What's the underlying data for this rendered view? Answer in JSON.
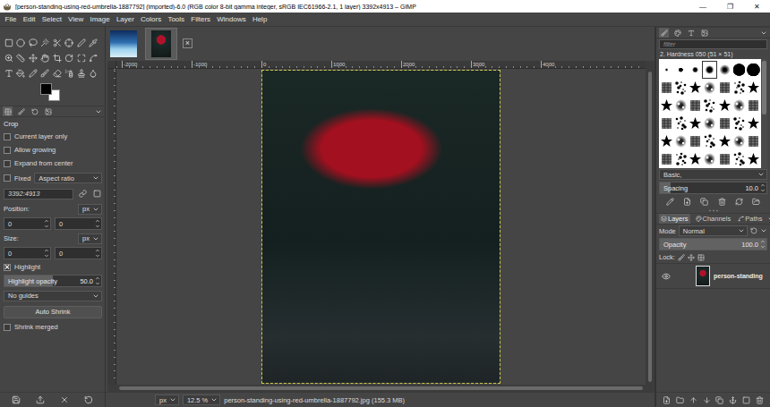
{
  "window": {
    "title": "[person-standing-using-red-umbrella-1887792] (imported)-6.0 (RGB color 8-bit gamma integer, sRGB IEC61966-2.1, 1 layer) 3392x4913 – GIMP",
    "controls": [
      "—",
      "❐",
      "✕"
    ]
  },
  "menu": [
    "File",
    "Edit",
    "Select",
    "View",
    "Image",
    "Layer",
    "Colors",
    "Tools",
    "Filters",
    "Windows",
    "Help"
  ],
  "image_tabs": {
    "items": [
      {
        "selected": false
      },
      {
        "selected": true
      }
    ],
    "close": "×"
  },
  "tool_options": {
    "tool": "Crop",
    "rows": [
      {
        "kind": "checkbox",
        "label": "Current layer only",
        "checked": false
      },
      {
        "kind": "checkbox",
        "label": "Allow growing",
        "checked": false
      },
      {
        "kind": "checkbox",
        "label": "Expand from center",
        "checked": false
      },
      {
        "kind": "fixed",
        "label": "Fixed",
        "checked": false,
        "value": "Aspect ratio"
      },
      {
        "kind": "field",
        "value": "3392:4913"
      },
      {
        "kind": "unit",
        "label": "Position:",
        "unit": "px"
      },
      {
        "kind": "pair",
        "values": [
          "0",
          "0"
        ]
      },
      {
        "kind": "unit",
        "label": "Size:",
        "unit": "px"
      },
      {
        "kind": "pair",
        "values": [
          "0",
          "0"
        ]
      },
      {
        "kind": "checkbox",
        "label": "Highlight",
        "checked": true
      },
      {
        "kind": "slider",
        "label": "Highlight opacity",
        "value": "50.0",
        "level": 0.5
      },
      {
        "kind": "dropdown",
        "value": "No guides"
      },
      {
        "kind": "button",
        "label": "Auto Shrink"
      },
      {
        "kind": "checkbox",
        "label": "Shrink merged",
        "checked": false
      }
    ]
  },
  "ruler": {
    "horizontal": [
      "-2000",
      "-1000",
      "0",
      "1000",
      "2000",
      "3000",
      "4000"
    ]
  },
  "status_bar": {
    "unit": "px",
    "zoom": "12.5 %",
    "file": "person-standing-using-red-umbrella-1887792.jpg (155.3 MB)"
  },
  "brush_dock": {
    "tabs": [
      {
        "selected": true
      },
      {
        "selected": false
      },
      {
        "selected": false
      },
      {
        "selected": false
      }
    ],
    "filter_placeholder": "filter",
    "brush_name": "2. Hardness 050 (51 × 51)",
    "brushes": [
      {
        "selected": false
      },
      {
        "selected": false
      },
      {
        "selected": false
      },
      {
        "selected": true
      },
      {
        "selected": false
      },
      {
        "selected": false
      },
      {
        "selected": false
      },
      {
        "selected": false
      },
      {
        "selected": false
      },
      {
        "selected": false
      },
      {
        "selected": false
      },
      {
        "selected": false
      },
      {
        "selected": false
      },
      {
        "selected": false
      },
      {
        "selected": false
      },
      {
        "selected": false
      },
      {
        "selected": false
      },
      {
        "selected": false
      },
      {
        "selected": false
      },
      {
        "selected": false
      },
      {
        "selected": false
      },
      {
        "selected": false
      },
      {
        "selected": false
      },
      {
        "selected": false
      },
      {
        "selected": false
      },
      {
        "selected": false
      },
      {
        "selected": false
      },
      {
        "selected": false
      },
      {
        "selected": false
      },
      {
        "selected": false
      },
      {
        "selected": false
      },
      {
        "selected": false
      },
      {
        "selected": false
      },
      {
        "selected": false
      },
      {
        "selected": false
      },
      {
        "selected": false
      },
      {
        "selected": false
      },
      {
        "selected": false
      },
      {
        "selected": false
      },
      {
        "selected": false
      },
      {
        "selected": false
      },
      {
        "selected": false
      }
    ],
    "tag": "Basic,",
    "spacing": {
      "label": "Spacing",
      "value": "10.0",
      "level": 0.1
    }
  },
  "layers_dock": {
    "tabs": [
      {
        "label": "Layers",
        "selected": true
      },
      {
        "label": "Channels",
        "selected": false
      },
      {
        "label": "Paths",
        "selected": false
      }
    ],
    "mode": {
      "label": "Mode",
      "value": "Normal"
    },
    "opacity": {
      "label": "Opacity",
      "value": "100.0",
      "level": 1.0
    },
    "lock_label": "Lock:",
    "layers": [
      {
        "name": "person-standing",
        "visible": true
      }
    ]
  }
}
